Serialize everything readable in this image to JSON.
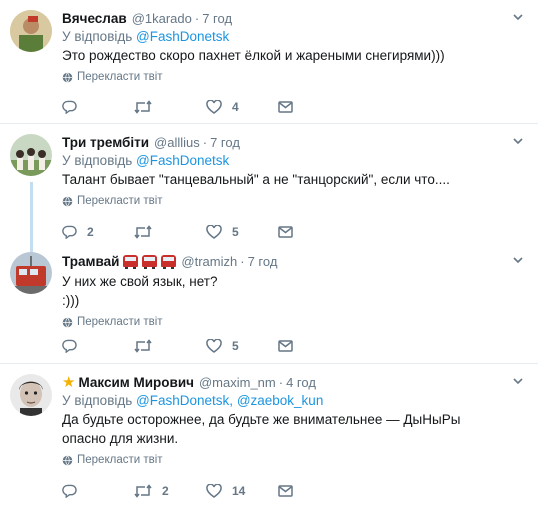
{
  "tweets": [
    {
      "name": "Вячеслав",
      "handle": "@1karado",
      "time": "7 год",
      "reply_prefix": "У відповідь",
      "reply_to": "@FashDonetsk",
      "text": "Это рождество скоро пахнет ёлкой и жареными снегирями)))",
      "translate": "Перекласти твіт",
      "replies": "",
      "retweets": "",
      "likes": "4"
    },
    {
      "name": "Три трембіти",
      "handle": "@alllius",
      "time": "7 год",
      "reply_prefix": "У відповідь",
      "reply_to": "@FashDonetsk",
      "text": "Талант бывает \"танцевальный\" а не \"танцорский\", если что....",
      "translate": "Перекласти твіт",
      "replies": "2",
      "retweets": "",
      "likes": "5"
    },
    {
      "name": "Трамвай",
      "handle": "@tramizh",
      "time": "7 год",
      "text_line1": "У них же свой язык, нет?",
      "text_line2": ":)))",
      "translate": "Перекласти твіт",
      "replies": "",
      "retweets": "",
      "likes": "5"
    },
    {
      "name": "Максим Мирович",
      "handle": "@maxim_nm",
      "time": "4 год",
      "reply_prefix": "У відповідь",
      "reply_to_1": "@FashDonetsk",
      "reply_to_2": "@zaebok_kun",
      "text": "Да будьте осторожнее, да будьте же внимательнее — ДыНыРы опасно для жизни.",
      "translate": "Перекласти твіт",
      "replies": "",
      "retweets": "2",
      "likes": "14"
    }
  ],
  "colors": {
    "link": "#1b95e0",
    "secondary": "#657786",
    "thread_line": "#c4ddef",
    "border": "#e6ecf0"
  },
  "icons": [
    "reply-icon",
    "retweet-icon",
    "like-icon",
    "message-icon",
    "globe-icon",
    "caret-down-icon",
    "star-icon",
    "tram-emoji"
  ]
}
